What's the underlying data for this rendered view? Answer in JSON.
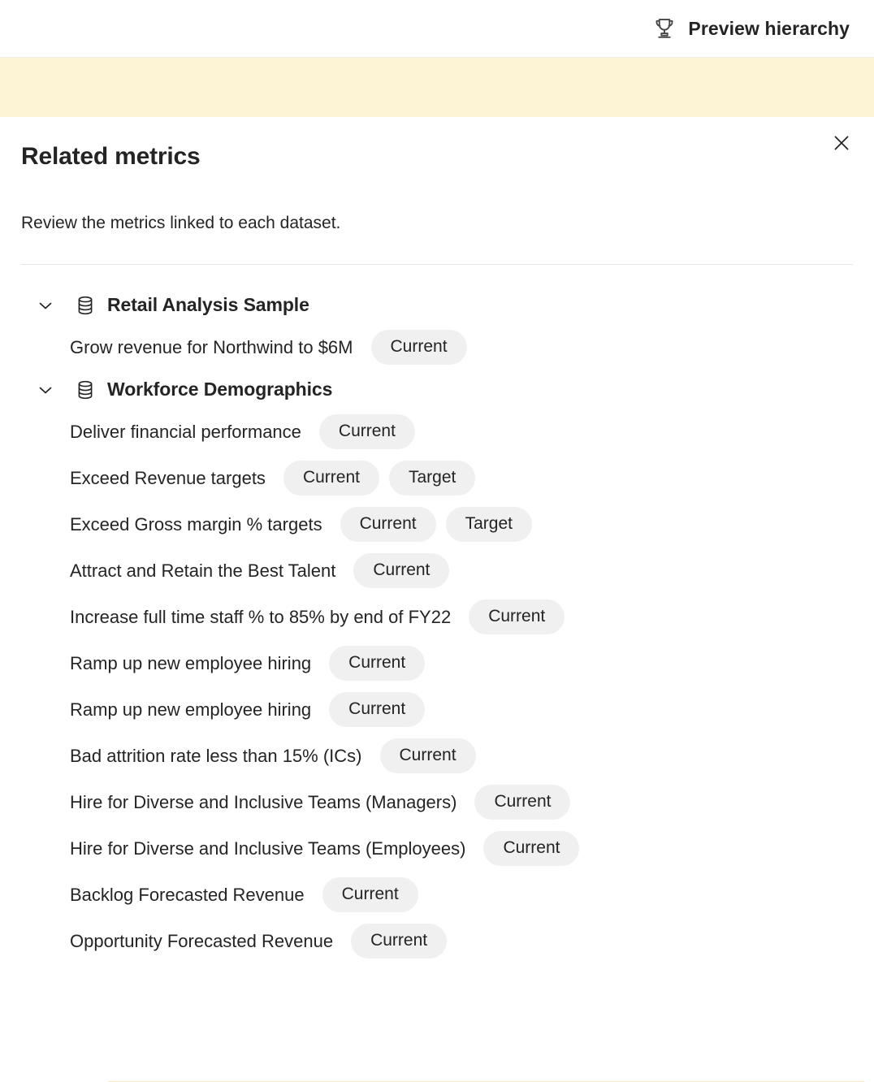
{
  "topbar": {
    "preview_hierarchy_label": "Preview hierarchy",
    "trophy_icon": "trophy-icon"
  },
  "banner": {
    "text": "",
    "background_color": "#fdf3d5"
  },
  "panel": {
    "title": "Related metrics",
    "subtitle": "Review the metrics linked to each dataset.",
    "close_icon": "close-icon"
  },
  "badge_colors": {
    "background": "#f0f0f0",
    "text": "#242424"
  },
  "groups": [
    {
      "name": "Retail Analysis Sample",
      "expanded": true,
      "chevron_icon": "chevron-down-icon",
      "dataset_icon": "database-icon",
      "metrics": [
        {
          "label": "Grow revenue for Northwind to $6M",
          "badges": [
            "Current"
          ]
        }
      ]
    },
    {
      "name": "Workforce Demographics",
      "expanded": true,
      "chevron_icon": "chevron-down-icon",
      "dataset_icon": "database-icon",
      "metrics": [
        {
          "label": "Deliver financial performance",
          "badges": [
            "Current"
          ]
        },
        {
          "label": "Exceed Revenue targets",
          "badges": [
            "Current",
            "Target"
          ]
        },
        {
          "label": "Exceed Gross margin % targets",
          "badges": [
            "Current",
            "Target"
          ]
        },
        {
          "label": "Attract and Retain the Best Talent",
          "badges": [
            "Current"
          ]
        },
        {
          "label": "Increase full time staff % to 85% by end of FY22",
          "badges": [
            "Current"
          ]
        },
        {
          "label": "Ramp up new employee hiring",
          "badges": [
            "Current"
          ]
        },
        {
          "label": "Ramp up new employee hiring",
          "badges": [
            "Current"
          ]
        },
        {
          "label": "Bad attrition rate less than 15% (ICs)",
          "badges": [
            "Current"
          ]
        },
        {
          "label": "Hire for Diverse and Inclusive Teams (Managers)",
          "badges": [
            "Current"
          ]
        },
        {
          "label": "Hire for Diverse and Inclusive Teams (Employees)",
          "badges": [
            "Current"
          ]
        },
        {
          "label": "Backlog Forecasted Revenue",
          "badges": [
            "Current"
          ]
        },
        {
          "label": "Opportunity Forecasted Revenue",
          "badges": [
            "Current"
          ]
        }
      ]
    }
  ]
}
